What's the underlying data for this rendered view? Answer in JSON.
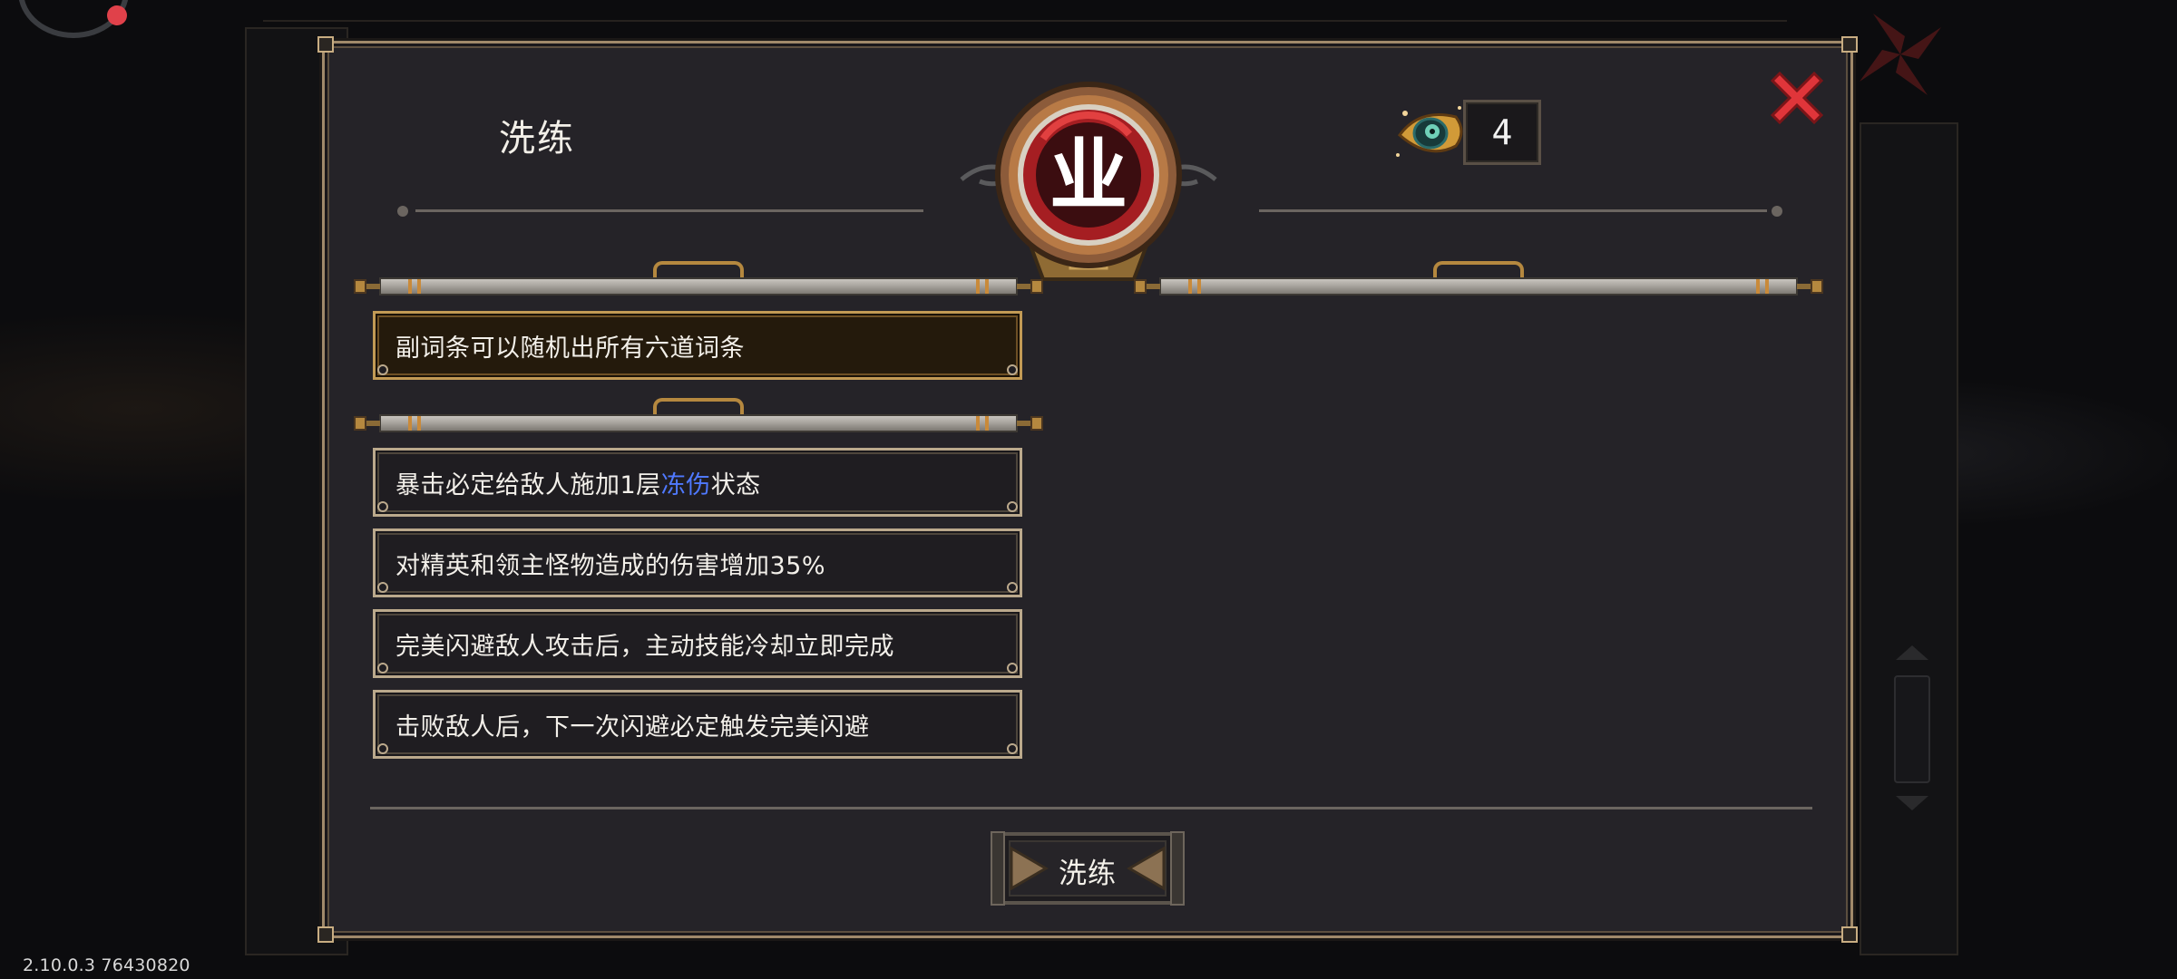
{
  "app": {
    "version": "2.10.0.3 76430820"
  },
  "dialog": {
    "title": "洗练",
    "close_icon": "close-x-icon",
    "currency": {
      "icon": "eye-orb-icon",
      "count": "4"
    },
    "emblem_glyph": "业",
    "affix_groups": [
      {
        "rows": [
          {
            "text": "副词条可以随机出所有六道词条"
          }
        ]
      },
      {
        "rows": [
          {
            "text_before": "暴击必定给敌人施加1层",
            "highlight": "冻伤",
            "text_after": "状态"
          },
          {
            "text": "对精英和领主怪物造成的伤害增加35%"
          },
          {
            "text": "完美闪避敌人攻击后，主动技能冷却立即完成"
          },
          {
            "text": "击败敌人后，下一次闪避必定触发完美闪避"
          }
        ]
      }
    ],
    "reforge_button": {
      "label": "洗练"
    }
  },
  "colors": {
    "panel_bg": "#252328",
    "frame": "#a0896a",
    "highlight_row_bg": "#241a0c",
    "frost_text": "#4f79ff",
    "close_red": "#e0353a",
    "emblem_red": "#c0282a"
  }
}
